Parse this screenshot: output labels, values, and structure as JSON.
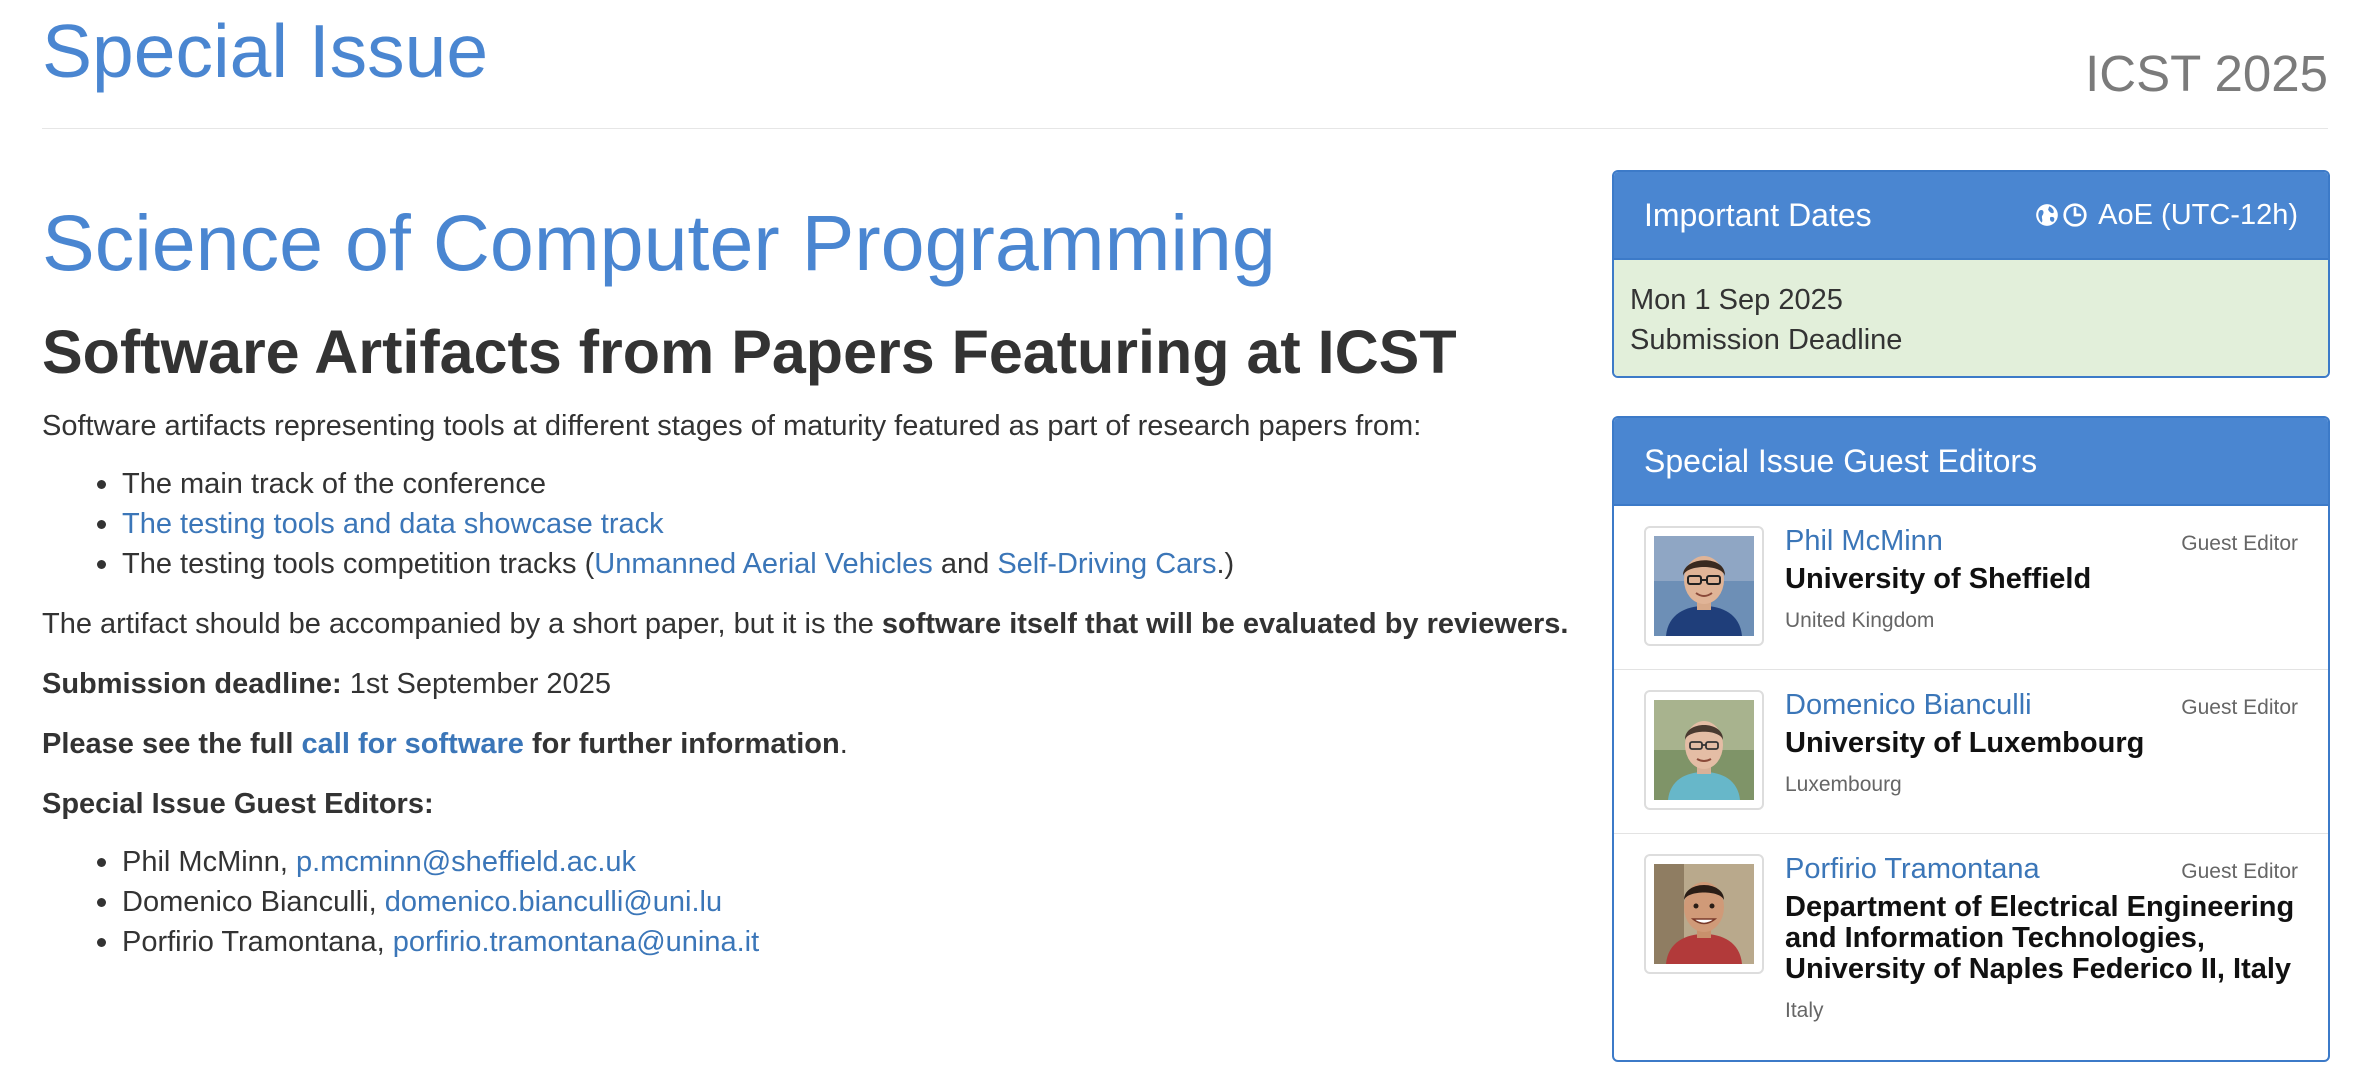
{
  "header": {
    "title": "Special Issue",
    "conference": "ICST 2025"
  },
  "main": {
    "journal_title": "Science of Computer Programming",
    "section_title": "Software Artifacts from Papers Featuring at ICST",
    "intro": "Software artifacts representing tools at different stages of maturity featured as part of research papers from:",
    "tracks": {
      "main_track": "The main track of the conference",
      "tools_track_link": "The testing tools and data showcase track",
      "competition_prefix": "The testing tools competition tracks (",
      "uav_link": "Unmanned Aerial Vehicles",
      "and": " and ",
      "sdc_link": "Self-Driving Cars",
      "competition_suffix": ".)"
    },
    "artifact_text": "The artifact should be accompanied by a short paper, but it is the ",
    "artifact_bold": "software itself that will be evaluated by reviewers.",
    "deadline_label": "Submission deadline:",
    "deadline_value": " 1st September 2025",
    "see_prefix": "Please see the full ",
    "see_link": "call for software",
    "see_suffix": " for further information",
    "period": ".",
    "editors_heading": "Special Issue Guest Editors:",
    "editors": [
      {
        "name": "Phil McMinn, ",
        "email": "p.mcminn@sheffield.ac.uk"
      },
      {
        "name": "Domenico Bianculli, ",
        "email": "domenico.bianculli@uni.lu"
      },
      {
        "name": "Porfirio Tramontana, ",
        "email": "porfirio.tramontana@unina.it"
      }
    ]
  },
  "dates_panel": {
    "title": "Important Dates",
    "timezone": "AoE (UTC-12h)",
    "timezone_icons": [
      "globe-icon",
      "clock-icon"
    ],
    "date": "Mon 1 Sep 2025",
    "event": "Submission Deadline",
    "background_color": "#e2efda"
  },
  "editors_panel": {
    "title": "Special Issue Guest Editors",
    "editors": [
      {
        "name": "Phil McMinn",
        "role": "Guest Editor",
        "affiliation": "University of Sheffield",
        "country": "United Kingdom"
      },
      {
        "name": "Domenico Bianculli",
        "role": "Guest Editor",
        "affiliation": "University of Luxembourg",
        "country": "Luxembourg"
      },
      {
        "name": "Porfirio Tramontana",
        "role": "Guest Editor",
        "affiliation": "Department of Electrical Engineering and Information Technologies, University of Naples Federico II, Italy",
        "country": "Italy"
      }
    ]
  },
  "colors": {
    "accent": "#4a86d1",
    "link": "#3b76b8",
    "panel_border": "#3c7ac8"
  }
}
